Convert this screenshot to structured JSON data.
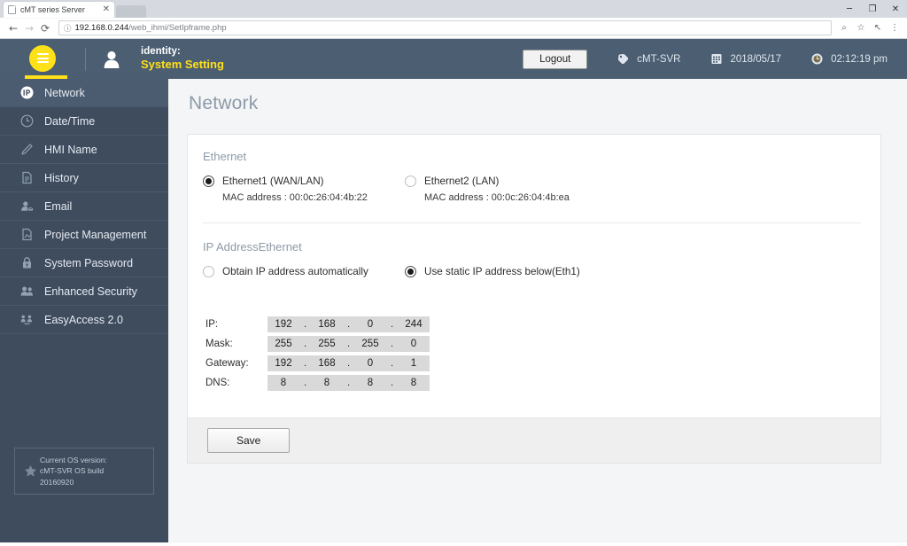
{
  "browser": {
    "tab_title": "cMT series Server",
    "tab_close": "✕",
    "back_icon": "←",
    "forward_icon": "→",
    "reload_icon": "⟳",
    "info_icon": "ⓘ",
    "url_host": "192.168.0.244",
    "url_path": "/web_ihmi/SetIpframe.php",
    "zoom_icon": "⌕",
    "star_icon": "☆",
    "share_icon": "↖",
    "menu_icon": "⋮",
    "minimize": "─",
    "maximize": "❐",
    "close": "✕"
  },
  "header": {
    "identity_label": "identity:",
    "identity_value": "System Setting",
    "logout_label": "Logout",
    "device_name": "cMT-SVR",
    "date": "2018/05/17",
    "time": "02:12:19 pm",
    "menu_icon_name": "hamburger-menu-icon",
    "accent_yellow": "#ffe119",
    "header_bg": "#4b5e72"
  },
  "sidebar": {
    "items": [
      {
        "label": "Network",
        "icon": "ip-icon",
        "active": true
      },
      {
        "label": "Date/Time",
        "icon": "clock-icon",
        "active": false
      },
      {
        "label": "HMI Name",
        "icon": "pencil-icon",
        "active": false
      },
      {
        "label": "History",
        "icon": "document-icon",
        "active": false
      },
      {
        "label": "Email",
        "icon": "contact-icon",
        "active": false
      },
      {
        "label": "Project Management",
        "icon": "project-file-icon",
        "active": false
      },
      {
        "label": "System Password",
        "icon": "lock-icon",
        "active": false
      },
      {
        "label": "Enhanced Security",
        "icon": "users-icon",
        "active": false
      },
      {
        "label": "EasyAccess 2.0",
        "icon": "easyaccess-icon",
        "active": false
      }
    ],
    "os_box": {
      "line1": "Current OS version:",
      "line2": "cMT-SVR OS build",
      "line3": "20160920",
      "icon": "star-icon"
    },
    "bg": "#3e4c5e",
    "active_bg": "#4b5c70"
  },
  "main": {
    "page_title": "Network",
    "ethernet": {
      "section_title": "Ethernet",
      "options": [
        {
          "label": "Ethernet1 (WAN/LAN)",
          "mac": "MAC address : 00:0c:26:04:4b:22",
          "checked": true
        },
        {
          "label": "Ethernet2 (LAN)",
          "mac": "MAC address : 00:0c:26:04:4b:ea",
          "checked": false
        }
      ]
    },
    "ip_address": {
      "section_title": "IP AddressEthernet",
      "options": [
        {
          "label": "Obtain IP address automatically",
          "checked": false
        },
        {
          "label": "Use static IP address below(Eth1)",
          "checked": true
        }
      ],
      "separator": ".",
      "rows": [
        {
          "label": "IP:",
          "octets": [
            "192",
            "168",
            "0",
            "244"
          ]
        },
        {
          "label": "Mask:",
          "octets": [
            "255",
            "255",
            "255",
            "0"
          ]
        },
        {
          "label": "Gateway:",
          "octets": [
            "192",
            "168",
            "0",
            "1"
          ]
        },
        {
          "label": "DNS:",
          "octets": [
            "8",
            "8",
            "8",
            "8"
          ]
        }
      ]
    },
    "save_label": "Save"
  }
}
